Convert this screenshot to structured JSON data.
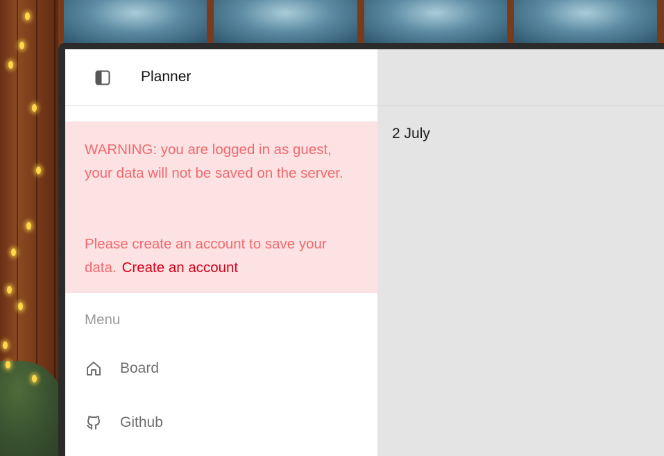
{
  "app": {
    "title": "Planner"
  },
  "warning": {
    "line1": "WARNING: you are logged in as guest, your data will not be saved on the server.",
    "line2": "Please create an account to save your data.",
    "link_label": "Create an account"
  },
  "menu": {
    "heading": "Menu",
    "items": [
      {
        "label": "Board",
        "icon": "home-icon"
      },
      {
        "label": "Github",
        "icon": "github-icon"
      }
    ]
  },
  "main": {
    "date": "2 July"
  },
  "colors": {
    "warning_bg": "#fde2e3",
    "warning_text": "#ef6a6f",
    "link": "#d0021b",
    "content_bg": "#e4e4e4"
  }
}
